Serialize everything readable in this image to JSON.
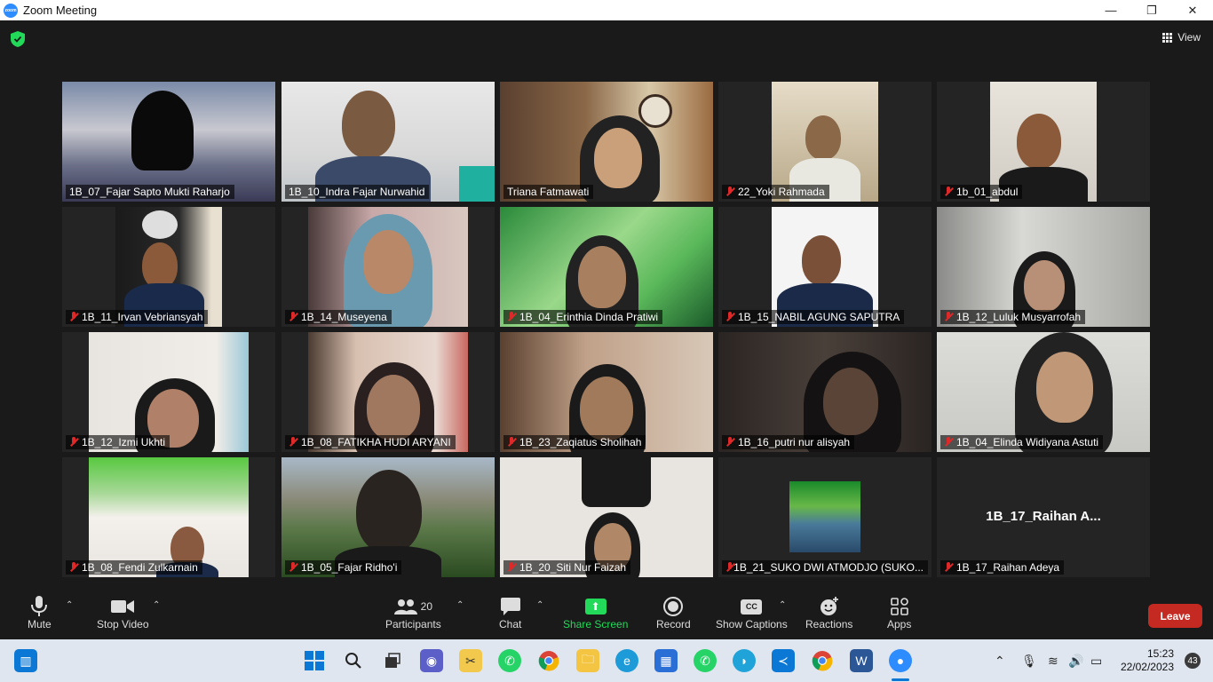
{
  "window": {
    "title": "Zoom Meeting",
    "minimize": "—",
    "maximize": "❐",
    "close": "✕"
  },
  "meeting": {
    "view_label": "View"
  },
  "participants": [
    {
      "name": "1B_07_Fajar Sapto Mukti Raharjo",
      "muted": false,
      "active": true
    },
    {
      "name": "1B_10_Indra Fajar Nurwahid",
      "muted": false
    },
    {
      "name": "Triana Fatmawati",
      "muted": false
    },
    {
      "name": "22_Yoki Rahmada",
      "muted": true
    },
    {
      "name": "1b_01_abdul",
      "muted": true
    },
    {
      "name": "1B_11_Irvan Vebriansyah",
      "muted": true
    },
    {
      "name": "1B_14_Museyena",
      "muted": true
    },
    {
      "name": "1B_04_Erinthia Dinda Pratiwi",
      "muted": true
    },
    {
      "name": "1B_15_NABIL AGUNG SAPUTRA",
      "muted": true
    },
    {
      "name": "1B_12_Luluk Musyarrofah",
      "muted": true
    },
    {
      "name": "1B_12_Izmi Ukhti",
      "muted": true
    },
    {
      "name": "1B_08_FATIKHA HUDI ARYANI",
      "muted": true
    },
    {
      "name": "1B_23_Zaqiatus Sholihah",
      "muted": true
    },
    {
      "name": "1B_16_putri nur alisyah",
      "muted": true
    },
    {
      "name": "1B_04_Elinda Widiyana Astuti",
      "muted": true
    },
    {
      "name": "1B_08_Fendi Zulkarnain",
      "muted": true
    },
    {
      "name": "1B_05_Fajar Ridho'i",
      "muted": true
    },
    {
      "name": "1B_20_Siti Nur Faizah",
      "muted": true
    },
    {
      "name": "1B_21_SUKO DWI ATMODJO (SUKO...",
      "muted": true
    },
    {
      "name": "1B_17_Raihan Adeya",
      "muted": true,
      "avatar_text": "1B_17_Raihan  A..."
    }
  ],
  "toolbar": {
    "mute": "Mute",
    "stop_video": "Stop Video",
    "participants": "Participants",
    "participants_count": "20",
    "chat": "Chat",
    "share_screen": "Share Screen",
    "record": "Record",
    "show_captions": "Show Captions",
    "reactions": "Reactions",
    "apps": "Apps",
    "leave": "Leave"
  },
  "taskbar": {
    "time": "15:23",
    "date": "22/02/2023",
    "notifications": "43"
  },
  "colors": {
    "accent_blue": "#2d8cff",
    "share_green": "#23d959",
    "leave_red": "#c52a22",
    "active_border": "#e8e85a",
    "muted_red": "#e02828"
  }
}
